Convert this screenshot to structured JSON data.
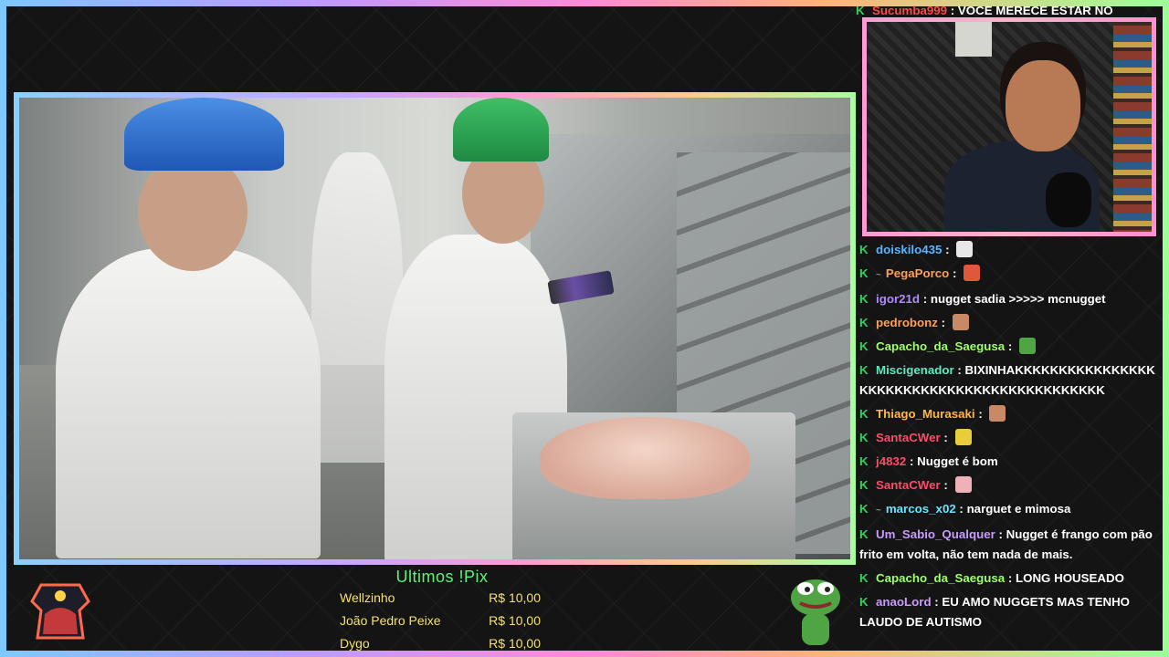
{
  "chat": {
    "top": {
      "user": "Sucumba999",
      "color": "#ff4a4a",
      "text": "VOCE MERECE ESTAR NO"
    },
    "messages": [
      {
        "user": "doiskilo435",
        "color": "#5ab4ff",
        "text": "",
        "emote": "skull-emote"
      },
      {
        "user": "PegaPorco",
        "color": "#ff9f5a",
        "text": "",
        "emote": "pig-face-emote",
        "badge": "~"
      },
      {
        "user": "igor21d",
        "color": "#b08cff",
        "text": "nugget sadia >>>>> mcnugget"
      },
      {
        "user": "pedrobonz",
        "color": "#ff9f5a",
        "text": "",
        "emote": "face-emote"
      },
      {
        "user": "Capacho_da_Saegusa",
        "color": "#9dff6a",
        "text": "",
        "emote": "pepe-emote"
      },
      {
        "user": "Miscigenador",
        "color": "#5eeac0",
        "text": "BIXINHAKKKKKKKKKKKKKKKKKKKKKKKKKKKKKKKKKKKKKKKKKKKK",
        "wrap": true
      },
      {
        "user": "Thiago_Murasaki",
        "color": "#ffb74a",
        "text": "",
        "emote": "face-emote"
      },
      {
        "user": "SantaCWer",
        "color": "#ff4a6a",
        "text": "",
        "emote": "banana-emote"
      },
      {
        "user": "j4832",
        "color": "#ff4a6a",
        "text": "Nugget é bom"
      },
      {
        "user": "SantaCWer",
        "color": "#ff4a6a",
        "text": "",
        "emote": "pink-emote"
      },
      {
        "user": "marcos_x02",
        "color": "#6ae3ff",
        "text": "narguet e mimosa",
        "badge": "~"
      },
      {
        "user": "Um_Sabio_Qualquer",
        "color": "#c89cff",
        "text": "Nugget é frango com pão frito em volta, não tem nada de mais.",
        "wrap": true
      },
      {
        "user": "Capacho_da_Saegusa",
        "color": "#9dff6a",
        "text": "LONG HOUSEADO"
      },
      {
        "user": "anaoLord",
        "color": "#c89cff",
        "text": "EU AMO NUGGETS MAS TENHO LAUDO DE AUTISMO",
        "wrap": true
      }
    ]
  },
  "pix": {
    "title": "Ultimos !Pix",
    "rows": [
      {
        "name": "Wellzinho",
        "amount": "R$ 10,00"
      },
      {
        "name": "João Pedro Peixe",
        "amount": "R$ 10,00"
      },
      {
        "name": "Dygo",
        "amount": "R$ 10,00"
      }
    ]
  },
  "colors": {
    "chat_badge": "#34d25b",
    "pix_title": "#5ef27a",
    "pix_text": "#f4e070"
  }
}
